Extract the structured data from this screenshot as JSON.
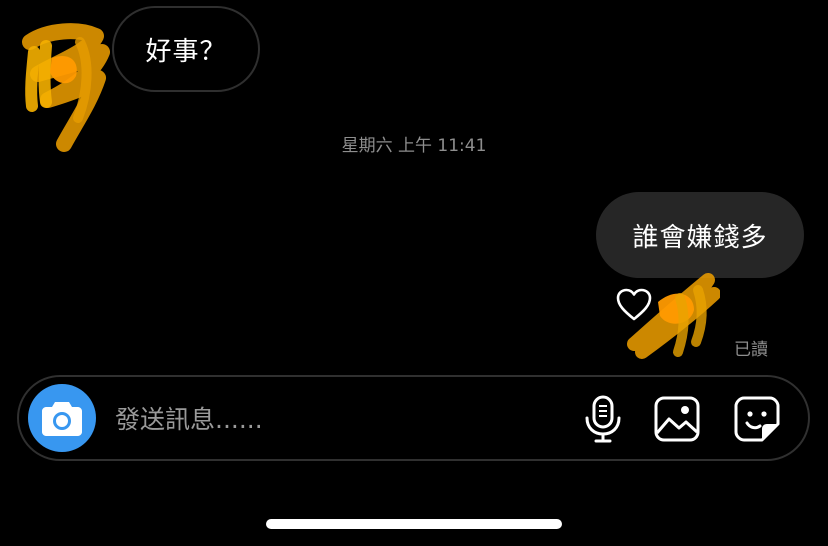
{
  "messages": {
    "incoming": {
      "text": "好事？"
    },
    "timestamp": "星期六 上午 11:41",
    "outgoing": {
      "text": "誰會嫌錢多",
      "reaction": "heart-icon"
    },
    "seen_status": "已讀"
  },
  "composer": {
    "placeholder": "發送訊息......",
    "value": "",
    "camera_icon": "camera-icon",
    "mic_icon": "microphone-icon",
    "gallery_icon": "image-gallery-icon",
    "sticker_icon": "sticker-icon"
  },
  "colors": {
    "background": "#000000",
    "outgoing_bubble": "#262626",
    "incoming_border": "#2f2f2f",
    "camera_accent": "#3897f0",
    "meta_text": "#8e8e8e",
    "redaction": "#ffb300"
  }
}
